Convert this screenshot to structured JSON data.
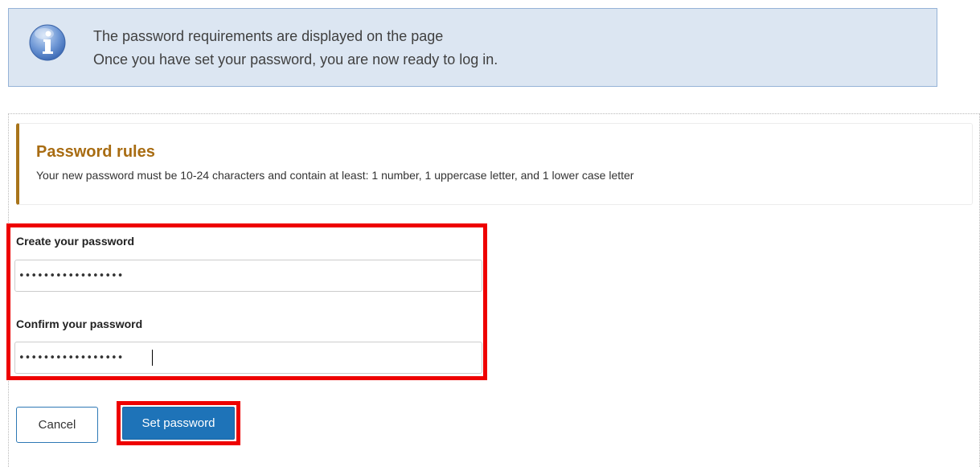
{
  "info": {
    "icon": "info-icon",
    "line1": "The password requirements are displayed on the page",
    "line2": "Once you have set your password, you are now ready to log in."
  },
  "rules": {
    "title": "Password rules",
    "description": "Your new password must be 10-24 characters and contain at least: 1 number, 1 uppercase letter, and 1 lower case letter"
  },
  "form": {
    "create_label": "Create your password",
    "create_value": "•••••••••••••••••",
    "confirm_label": "Confirm your password",
    "confirm_value": "•••••••••••••••••"
  },
  "buttons": {
    "cancel": "Cancel",
    "set_password": "Set password"
  },
  "colors": {
    "banner_bg": "#dce6f2",
    "rules_accent": "#a8741a",
    "primary": "#1e73b8",
    "highlight": "#ee0000"
  }
}
